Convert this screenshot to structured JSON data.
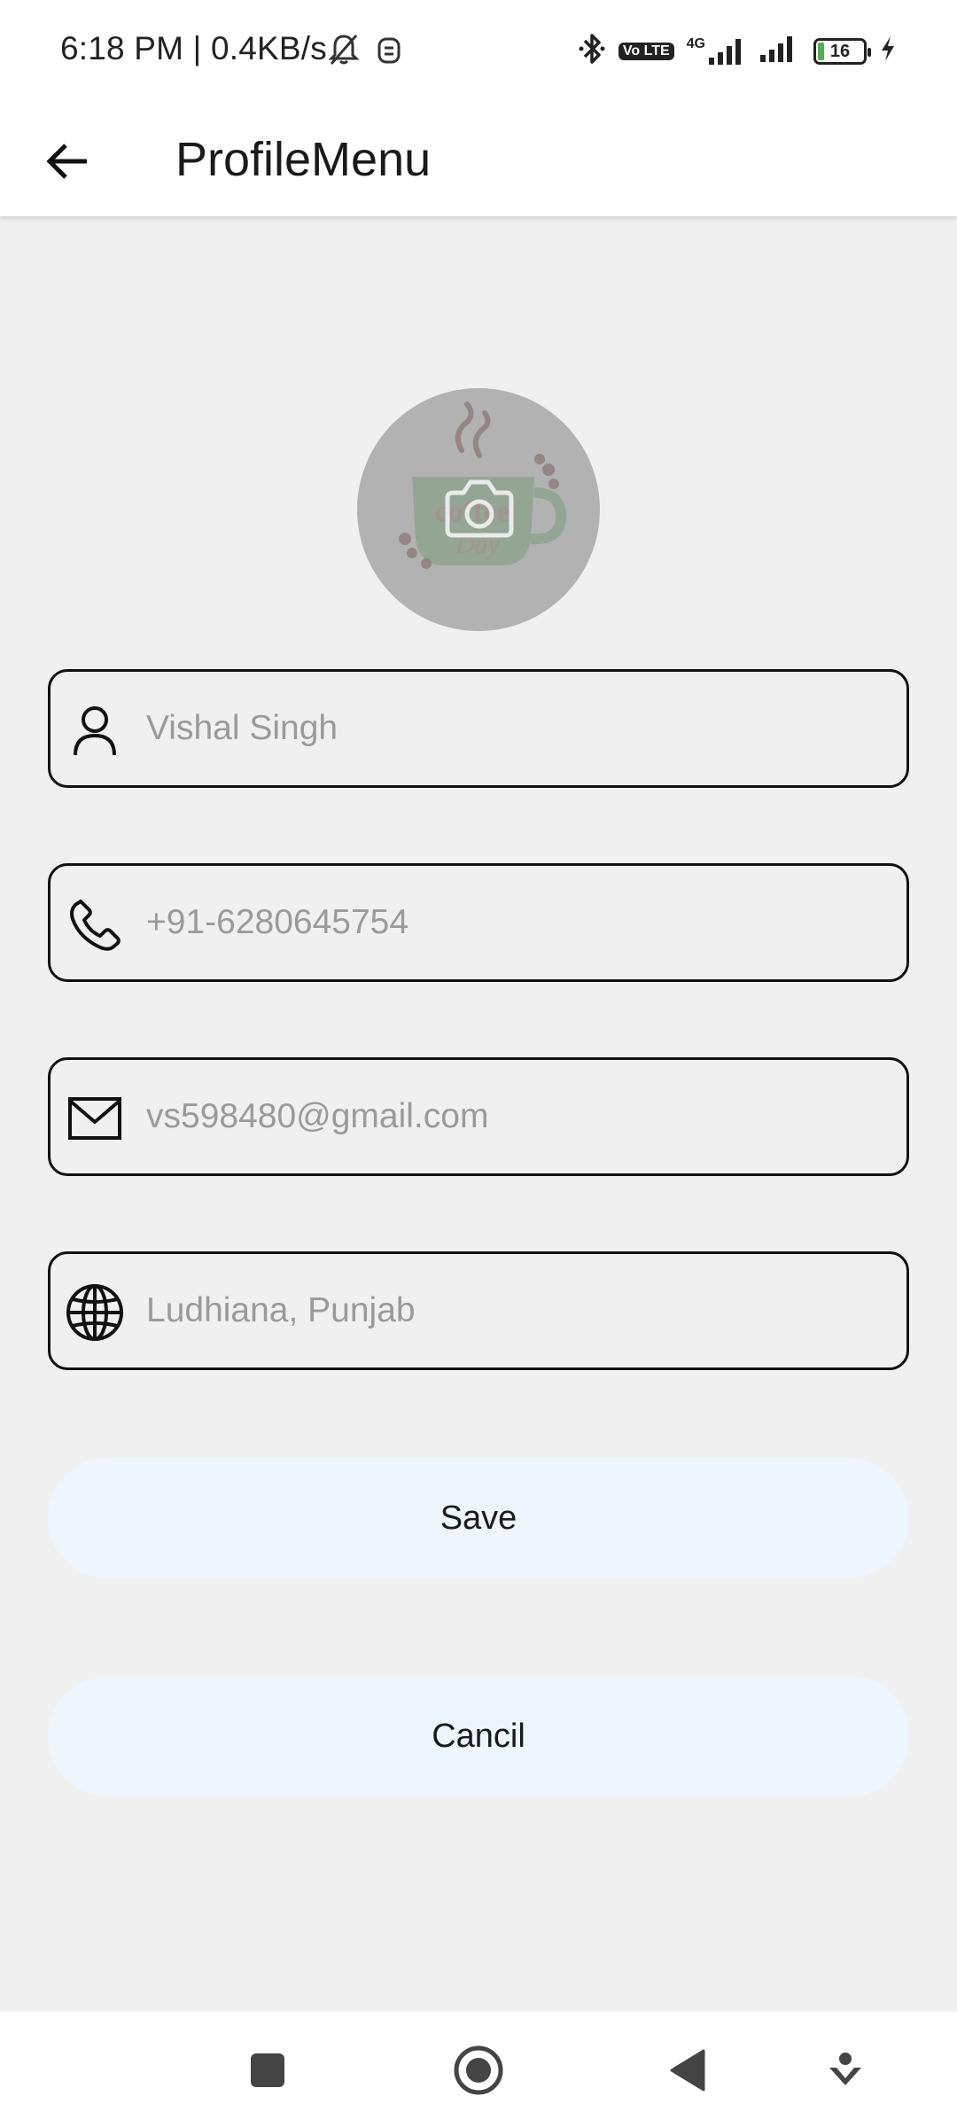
{
  "status_bar": {
    "time_network": "6:18 PM | 0.4KB/s",
    "network_type": "4G",
    "volte_label": "Vo LTE",
    "battery_level": "16",
    "icons": [
      "bell-muted-icon",
      "sim-icon",
      "bluetooth-icon",
      "volte-icon",
      "signal-icon",
      "battery-icon",
      "charging-icon"
    ]
  },
  "app_bar": {
    "title": "ProfileMenu",
    "back_icon": "arrow-left-icon"
  },
  "profile": {
    "avatar_icon": "camera-icon",
    "logo_text": "coffee Day"
  },
  "form": {
    "name": {
      "placeholder": "Vishal Singh",
      "value": "",
      "icon": "person-icon"
    },
    "phone": {
      "placeholder": "+91-6280645754",
      "value": "",
      "icon": "phone-icon"
    },
    "email": {
      "placeholder": "vs598480@gmail.com",
      "value": "",
      "icon": "mail-icon"
    },
    "location": {
      "placeholder": "Ludhiana, Punjab",
      "value": "",
      "icon": "globe-icon"
    }
  },
  "actions": {
    "save_label": "Save",
    "cancel_label": "Cancil"
  },
  "colors": {
    "background": "#f0f0f0",
    "button_bg": "#eef5fc",
    "avatar_bg": "#b3b2b2",
    "border": "#111111",
    "placeholder": "#9a9a9a"
  },
  "nav": {
    "items": [
      "recents-icon",
      "home-icon",
      "back-icon",
      "menu-icon"
    ]
  }
}
